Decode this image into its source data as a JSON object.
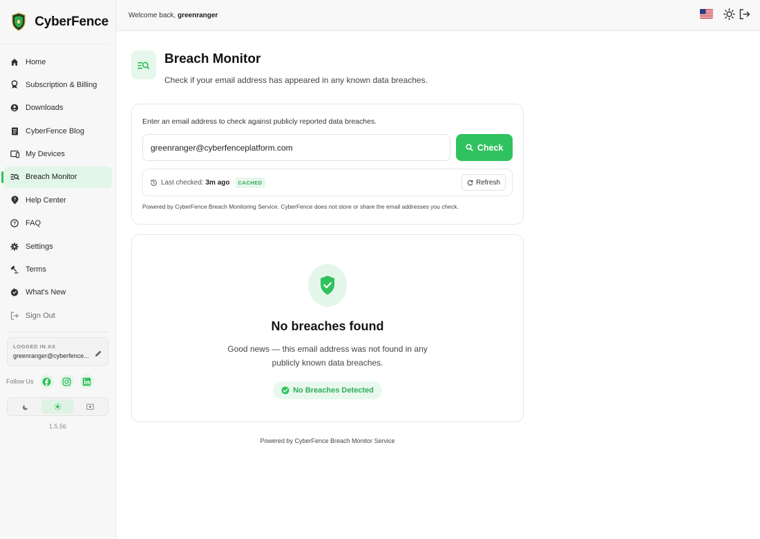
{
  "brand": {
    "name": "CyberFence",
    "logo_icon": "shield-logo-icon"
  },
  "sidebar": {
    "items": [
      {
        "label": "Home",
        "icon": "home-icon"
      },
      {
        "label": "Subscription & Billing",
        "icon": "badge-icon"
      },
      {
        "label": "Downloads",
        "icon": "download-circle-icon"
      },
      {
        "label": "CyberFence Blog",
        "icon": "blog-icon"
      },
      {
        "label": "My Devices",
        "icon": "devices-icon"
      },
      {
        "label": "Breach Monitor",
        "icon": "breach-search-icon",
        "active": true
      },
      {
        "label": "Help Center",
        "icon": "help-pin-icon"
      },
      {
        "label": "FAQ",
        "icon": "question-circle-icon"
      },
      {
        "label": "Settings",
        "icon": "gear-icon"
      },
      {
        "label": "Terms",
        "icon": "gavel-icon"
      },
      {
        "label": "What's New",
        "icon": "new-badge-icon"
      },
      {
        "label": "Sign Out",
        "icon": "sign-out-icon",
        "muted": true
      }
    ],
    "logged_in_label": "LOGGED IN AS",
    "logged_in_email": "greenranger@cyberfence...",
    "follow_label": "Follow Us",
    "version": "1.5.56"
  },
  "header": {
    "welcome_prefix": "Welcome back,",
    "username": "greenranger"
  },
  "page": {
    "title": "Breach Monitor",
    "subtitle": "Check if your email address has appeared in any known data breaches."
  },
  "check_card": {
    "lead": "Enter an email address to check against publicly reported data breaches.",
    "email_value": "greenranger@cyberfenceplatform.com",
    "check_label": "Check",
    "last_checked_label": "Last checked:",
    "last_checked_value": "3m ago",
    "cached_badge": "CACHED",
    "refresh_label": "Refresh",
    "powered_text": "Powered by CyberFence Breach Monitoring Service. CyberFence does not store or share the email addresses you check."
  },
  "result_card": {
    "title": "No breaches found",
    "description": "Good news — this email address was not found in any publicly known data breaches.",
    "pill_label": "No Breaches Detected"
  },
  "footer": {
    "text": "Powered by CyberFence Breach Monitor Service"
  },
  "colors": {
    "accent": "#30c25e",
    "accent_soft": "#e6f7ec"
  }
}
